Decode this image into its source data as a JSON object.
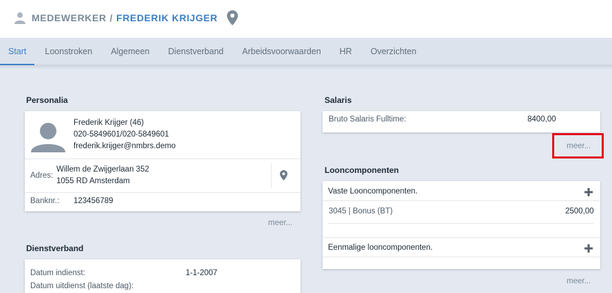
{
  "header": {
    "section": "MEDEWERKER",
    "separator": "/",
    "employee_name": "FREDERIK KRIJGER"
  },
  "tabs": [
    {
      "label": "Start",
      "active": true
    },
    {
      "label": "Loonstroken"
    },
    {
      "label": "Algemeen"
    },
    {
      "label": "Dienstverband"
    },
    {
      "label": "Arbeidsvoorwaarden"
    },
    {
      "label": "HR"
    },
    {
      "label": "Overzichten"
    }
  ],
  "personalia": {
    "title": "Personalia",
    "name_age": "Frederik Krijger (46)",
    "phone": "020-5849601/020-5849601",
    "email": "frederik.krijger@nmbrs.demo",
    "address_label": "Adres:",
    "address_line1": "Willem de Zwijgerlaan 352",
    "address_line2": "1055 RD Amsterdam",
    "bank_label": "Banknr.:",
    "bank_value": "123456789",
    "more": "meer..."
  },
  "dienstverband": {
    "title": "Dienstverband",
    "start_label": "Datum indienst:",
    "start_value": "1-1-2007",
    "end_label": "Datum uitdienst (laatste dag):"
  },
  "salaris": {
    "title": "Salaris",
    "label": "Bruto Salaris Fulltime:",
    "value": "8400,00",
    "more": "meer..."
  },
  "looncomponenten": {
    "title": "Looncomponenten",
    "fixed_title": "Vaste Looncomponenten.",
    "fixed_items": [
      {
        "label": "3045 | Bonus (BT)",
        "value": "2500,00"
      }
    ],
    "onetime_title": "Eenmalige looncomponenten.",
    "more": "meer..."
  },
  "colors": {
    "accent": "#3b7fc4",
    "highlight": "#e0101b",
    "background": "#e4e9f1"
  }
}
